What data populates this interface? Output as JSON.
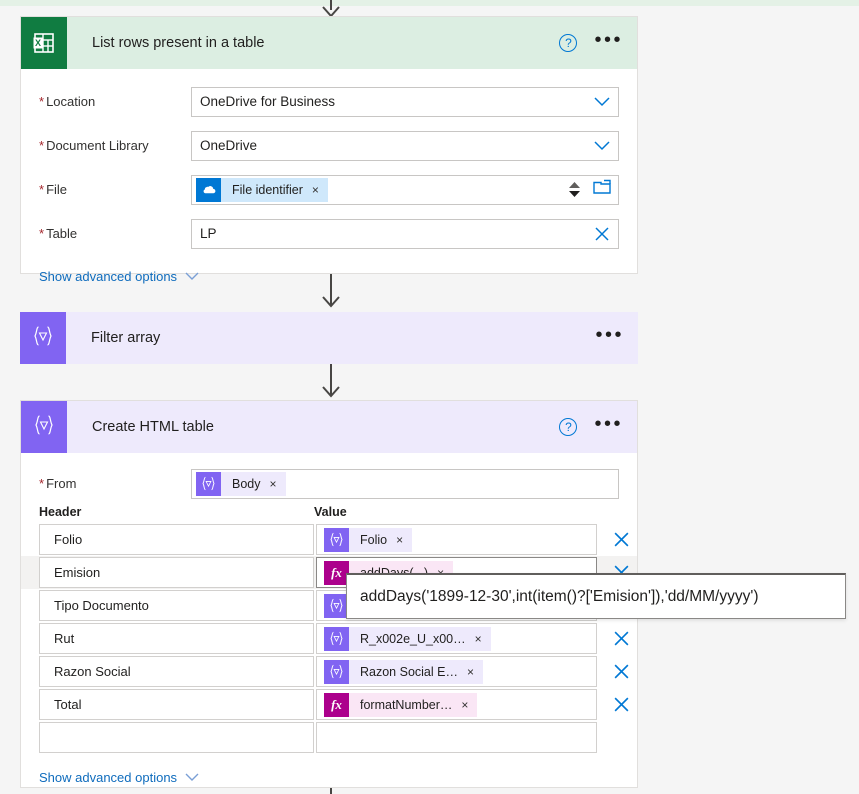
{
  "flow": {
    "cards": [
      {
        "id": "list-rows",
        "title": "List rows present in a table",
        "icon": "excel-icon",
        "theme": "excel",
        "help_label": "?",
        "more_label": "•••",
        "advanced_label": "Show advanced options",
        "fields": [
          {
            "label": "Location",
            "required": true,
            "value": "OneDrive for Business",
            "affix": "chevron-down-icon"
          },
          {
            "label": "Document Library",
            "required": true,
            "value": "OneDrive",
            "affix": "chevron-down-icon"
          },
          {
            "label": "File",
            "required": true,
            "value": "",
            "token": {
              "icon": "onedrive-icon",
              "kind": "onedrive",
              "text": "File identifier",
              "remove": "×"
            },
            "affix": "spinner-folder-icons"
          },
          {
            "label": "Table",
            "required": true,
            "value": "LP",
            "affix": "clear-x-icon"
          }
        ]
      },
      {
        "id": "filter-array",
        "title": "Filter array",
        "icon": "dynamic-content-icon",
        "theme": "purple",
        "more_label": "•••"
      },
      {
        "id": "create-html-table",
        "title": "Create HTML table",
        "icon": "dynamic-content-icon",
        "theme": "purple",
        "help_label": "?",
        "more_label": "•••",
        "advanced_label": "Show advanced options",
        "from_field": {
          "label": "From",
          "required": true,
          "token": {
            "icon": "dynamic-content-icon",
            "kind": "dyn",
            "text": "Body",
            "remove": "×"
          }
        },
        "table": {
          "columns": [
            "Header",
            "Value"
          ],
          "rows": [
            {
              "header": "Folio",
              "value": {
                "kind": "dyn",
                "icon": "dynamic-content-icon",
                "text": "Folio",
                "remove": "×"
              },
              "delete": "✕"
            },
            {
              "header": "Emision",
              "value": {
                "kind": "expr",
                "icon": "expression-icon",
                "text": "addDays(...)",
                "remove": "×"
              },
              "delete": "✕",
              "focused": true
            },
            {
              "header": "Tipo Documento",
              "value": {
                "kind": "dyn",
                "icon": "dynamic-content-icon",
                "text": "",
                "remove": ""
              },
              "delete": "✕"
            },
            {
              "header": "Rut",
              "value": {
                "kind": "dyn",
                "icon": "dynamic-content-icon",
                "text": "R_x002e_U_x00…",
                "remove": "×"
              },
              "delete": "✕"
            },
            {
              "header": "Razon Social",
              "value": {
                "kind": "dyn",
                "icon": "dynamic-content-icon",
                "text": "Razon Social E…",
                "remove": "×"
              },
              "delete": "✕"
            },
            {
              "header": "Total",
              "value": {
                "kind": "expr",
                "icon": "expression-icon",
                "text": "formatNumber…",
                "remove": "×"
              },
              "delete": "✕"
            },
            {
              "header": "",
              "value": {
                "kind": "empty",
                "icon": "",
                "text": "",
                "remove": ""
              },
              "delete": ""
            }
          ]
        }
      }
    ]
  },
  "tooltip": {
    "name": "expression-preview",
    "text": "addDays('1899-12-30',int(item()?['Emision']),'dd/MM/yyyy')"
  },
  "colors": {
    "excel_green": "#107c41",
    "excel_header_bg": "#dceee2",
    "purple": "#8164f2",
    "purple_header_bg": "#eeeafc",
    "expression_magenta": "#ac008c",
    "link_blue": "#0f6cbd",
    "required_red": "#a4262c"
  }
}
